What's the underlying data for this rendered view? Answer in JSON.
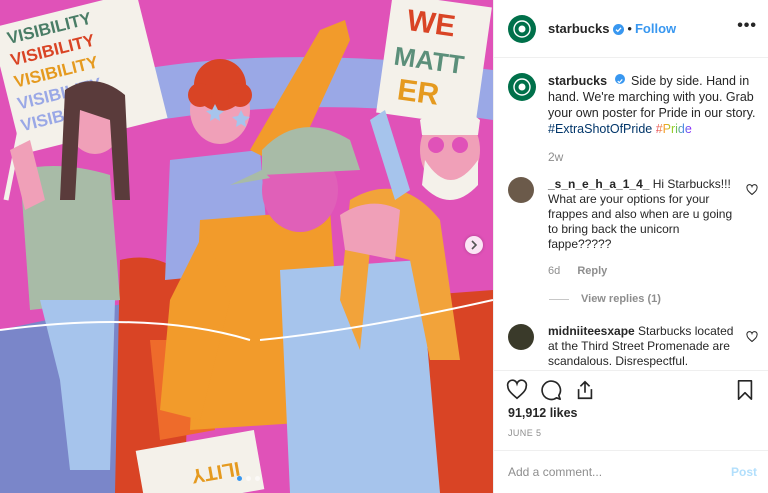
{
  "post": {
    "account": "starbucks",
    "header_separator": "•",
    "follow_label": "Follow",
    "more_label": "•••",
    "caption": {
      "text": "Side by side. Hand in hand. We're marching with you. Grab your own poster for Pride in our story.",
      "hashtag_1": "#ExtraShotOfPride",
      "hashtag_2": "#Pride",
      "time": "2w"
    },
    "comments": [
      {
        "username": "_s_n_e_h_a_1_4_",
        "text": "Hi Starbucks!!! What are your options for your frappes and also when are u going to bring back the unicorn fappe?????",
        "time": "6d",
        "reply_label": "Reply",
        "view_replies": "View replies (1)"
      },
      {
        "username": "midniiteesxape",
        "text": "Starbucks located at the Third Street Promenade are scandalous. Disrespectful."
      }
    ],
    "likes": "91,912 likes",
    "date": "JUNE 5",
    "add_comment_placeholder": "Add a comment...",
    "post_label": "Post"
  },
  "illustration": {
    "sign_left_lines": [
      "VISIBILITY",
      "VISIBILITY",
      "VISIBILITY",
      "VISIBILITY",
      "VISIBILI"
    ],
    "sign_right_lines": [
      "WE",
      "MATT",
      "ER"
    ],
    "sign_bottom": "ILITY"
  },
  "colors": {
    "accent": "#3897f0",
    "brand": "#00704a",
    "background": "#e052b8"
  },
  "icons": {
    "like": "heart-icon",
    "comment": "comment-icon",
    "share": "share-icon",
    "save": "bookmark-icon",
    "next": "chevron-right-icon",
    "more": "more-horizontal-icon"
  }
}
